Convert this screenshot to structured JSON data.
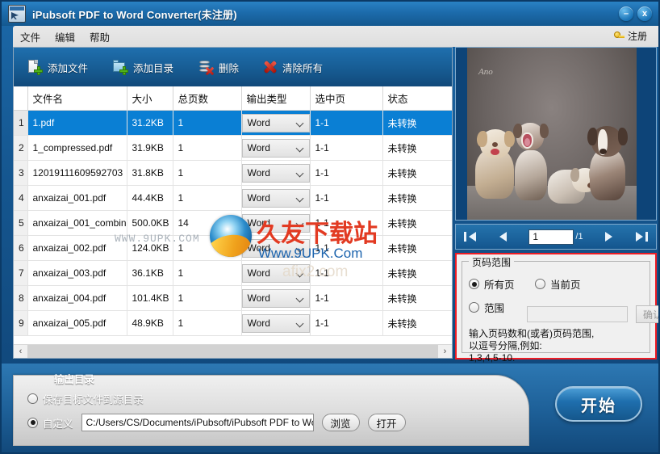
{
  "window": {
    "title": "iPubsoft PDF to Word Converter(未注册)",
    "app_icon": "pdf-converter-icon",
    "minimize_label": "–",
    "close_label": "x"
  },
  "menu": {
    "items": [
      {
        "label": "文件",
        "name": "menu-file"
      },
      {
        "label": "编辑",
        "name": "menu-edit"
      },
      {
        "label": "帮助",
        "name": "menu-help"
      }
    ],
    "register_label": "注册",
    "register_icon": "key-icon"
  },
  "toolbar": {
    "buttons": [
      {
        "label": "添加文件",
        "icon": "add-file-icon"
      },
      {
        "label": "添加目录",
        "icon": "add-folder-icon"
      },
      {
        "label": "删除",
        "icon": "delete-icon"
      },
      {
        "label": "清除所有",
        "icon": "clear-all-icon"
      }
    ]
  },
  "table": {
    "headers": [
      "",
      "文件名",
      "大小",
      "总页数",
      "输出类型",
      "选中页",
      "状态"
    ],
    "rows": [
      {
        "num": "1",
        "name": "1.pdf",
        "size": "31.2KB",
        "pages": "1",
        "type": "Word",
        "selpages": "1-1",
        "status": "未转换",
        "selected": true
      },
      {
        "num": "2",
        "name": "1_compressed.pdf",
        "size": "31.9KB",
        "pages": "1",
        "type": "Word",
        "selpages": "1-1",
        "status": "未转换",
        "selected": false
      },
      {
        "num": "3",
        "name": "12019111609592703",
        "size": "31.8KB",
        "pages": "1",
        "type": "Word",
        "selpages": "1-1",
        "status": "未转换",
        "selected": false
      },
      {
        "num": "4",
        "name": "anxaizai_001.pdf",
        "size": "44.4KB",
        "pages": "1",
        "type": "Word",
        "selpages": "1-1",
        "status": "未转换",
        "selected": false
      },
      {
        "num": "5",
        "name": "anxaizai_001_combin",
        "size": "500.0KB",
        "pages": "14",
        "type": "Word",
        "selpages": "1-1",
        "status": "未转换",
        "selected": false
      },
      {
        "num": "6",
        "name": "anxaizai_002.pdf",
        "size": "124.0KB",
        "pages": "1",
        "type": "Word",
        "selpages": "1-1",
        "status": "未转换",
        "selected": false
      },
      {
        "num": "7",
        "name": "anxaizai_003.pdf",
        "size": "36.1KB",
        "pages": "1",
        "type": "Word",
        "selpages": "1-1",
        "status": "未转换",
        "selected": false
      },
      {
        "num": "8",
        "name": "anxaizai_004.pdf",
        "size": "101.4KB",
        "pages": "1",
        "type": "Word",
        "selpages": "1-1",
        "status": "未转换",
        "selected": false
      },
      {
        "num": "9",
        "name": "anxaizai_005.pdf",
        "size": "48.9KB",
        "pages": "1",
        "type": "Word",
        "selpages": "1-1",
        "status": "未转換",
        "selected": false
      }
    ],
    "scroll_left_label": "‹",
    "scroll_right_label": "›"
  },
  "preview": {
    "image_alt": "five-puppies-photo-preview",
    "signature": "Ano",
    "nav": {
      "first_label": "first-page",
      "prev_label": "prev-page",
      "next_label": "next-page",
      "last_label": "last-page",
      "current_page": "1",
      "total_pages": "/1"
    }
  },
  "page_range": {
    "group_title": "页码范围",
    "options": [
      {
        "label": "所有页",
        "selected": true
      },
      {
        "label": "当前页",
        "selected": false
      },
      {
        "label": "范围",
        "selected": false
      }
    ],
    "range_value": "",
    "confirm_label": "确认",
    "hint_lines": [
      "输入页码数和(或者)页码范围,",
      "以逗号分隔,例如:",
      "1,3,4,5-10."
    ]
  },
  "output": {
    "title": "输出目录",
    "option_source_label": "保存目标文件到源目录",
    "option_source_selected": false,
    "option_custom_label": "自定义",
    "option_custom_selected": true,
    "path_value": "C:/Users/CS/Documents/iPubsoft/iPubsoft PDF to Word Converter",
    "browse_label": "浏览",
    "open_label": "打开",
    "start_label": "开始"
  },
  "watermark": {
    "title_cn": "久友下载站",
    "url": "Www.9UPK.Com",
    "url_small": "WWW.9UPK.COM",
    "ghost": "afix2.com"
  },
  "colors": {
    "accent_blue": "#1f6fae",
    "selection_blue": "#0a7fd4",
    "highlight_red": "#ee1c24",
    "title_bar": "#2a82c4"
  }
}
